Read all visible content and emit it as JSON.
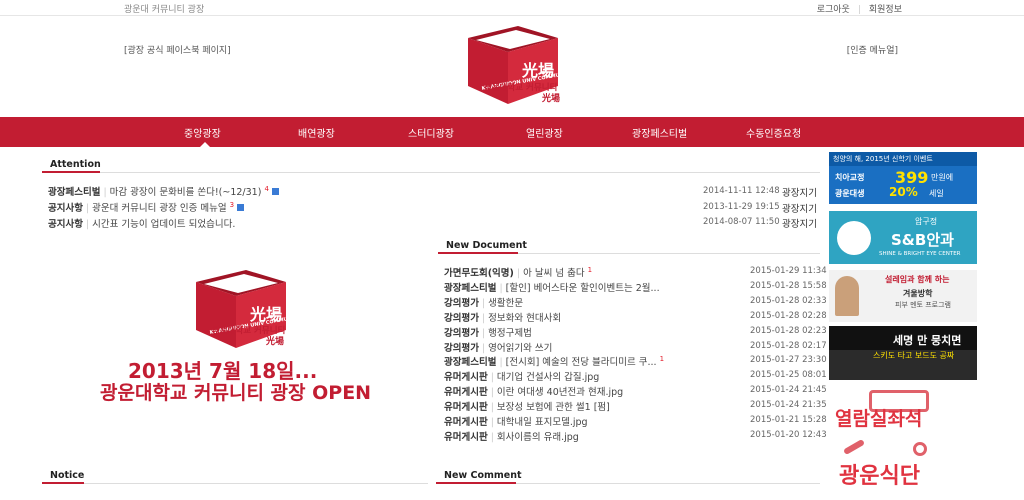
{
  "topbar": {
    "site_name": "광운대 커뮤니티 광장",
    "logout": "로그아웃",
    "member_info": "회원정보"
  },
  "header": {
    "left_link": "[광장 공식 페이스북 페이지]",
    "right_link": "[인증 메뉴얼]",
    "logo_text_main": "光場",
    "logo_text_sub": "광운대학교 커뮤니티",
    "logo_text_sub2": "光場",
    "logo_side": "KWANGWOON UNIV COMMUNITY"
  },
  "nav": {
    "items": [
      "중앙광장",
      "배연광장",
      "스터디광장",
      "열린광장",
      "광장페스티벌",
      "수동인증요청"
    ]
  },
  "attention": {
    "title": "Attention",
    "rows": [
      {
        "category": "광장페스티벌",
        "title": "마감 광장이 문화비를 쏜다!(~12/31)",
        "count": "4",
        "date": "2014-11-11",
        "time": "12:48",
        "author": "광장지기"
      },
      {
        "category": "공지사항",
        "title": "광운대 커뮤니티 광장 인증 메뉴얼",
        "count": "3",
        "date": "2013-11-29",
        "time": "19:15",
        "author": "광장지기"
      },
      {
        "category": "공지사항",
        "title": "시간표 기능이 업데이트 되었습니다.",
        "count": "",
        "date": "2014-08-07",
        "time": "11:50",
        "author": "광장지기"
      }
    ]
  },
  "banner": {
    "line1": "2013년 7월 18일...",
    "line2": "광운대학교 커뮤니티 광장 OPEN",
    "logo_main": "光場",
    "logo_sub": "광운대학교 커뮤니티",
    "logo_sub2": "光場",
    "logo_side": "KWANGWOON UNIV COMMUNITY"
  },
  "new_document": {
    "title": "New Document",
    "rows": [
      {
        "category": "가면무도회(익명)",
        "title": "아 날씨 넘 춥다",
        "count": "1",
        "date": "2015-01-29",
        "time": "11:34"
      },
      {
        "category": "광장페스티벌",
        "title": "[할인] 베어스타운 할인이벤트는 2월...",
        "count": "",
        "date": "2015-01-28",
        "time": "15:58"
      },
      {
        "category": "강의평가",
        "title": "생활한문",
        "count": "",
        "date": "2015-01-28",
        "time": "02:33"
      },
      {
        "category": "강의평가",
        "title": "정보화와 현대사회",
        "count": "",
        "date": "2015-01-28",
        "time": "02:28"
      },
      {
        "category": "강의평가",
        "title": "행정구제법",
        "count": "",
        "date": "2015-01-28",
        "time": "02:23"
      },
      {
        "category": "강의평가",
        "title": "영어읽기와 쓰기",
        "count": "",
        "date": "2015-01-28",
        "time": "02:17"
      },
      {
        "category": "광장페스티벌",
        "title": "[전시회] 예술의 전당 블라디미르 쿠...",
        "count": "1",
        "date": "2015-01-27",
        "time": "23:30"
      },
      {
        "category": "유머게시판",
        "title": "대기업 건설사의 갑질.jpg",
        "count": "",
        "date": "2015-01-25",
        "time": "08:01"
      },
      {
        "category": "유머게시판",
        "title": "이란 여대생 40년전과 현재.jpg",
        "count": "",
        "date": "2015-01-24",
        "time": "21:45"
      },
      {
        "category": "유머게시판",
        "title": "보장성 보험에 관한 썰1 [펌]",
        "count": "",
        "date": "2015-01-24",
        "time": "21:35"
      },
      {
        "category": "유머게시판",
        "title": "대학내일 표지모델.jpg",
        "count": "",
        "date": "2015-01-21",
        "time": "15:28"
      },
      {
        "category": "유머게시판",
        "title": "회사이름의 유래.jpg",
        "count": "",
        "date": "2015-01-20",
        "time": "12:43"
      }
    ]
  },
  "notice": {
    "title": "Notice"
  },
  "new_comment": {
    "title": "New Comment"
  },
  "ads": {
    "ad1": {
      "line1": "청양의 해, 2015년 신학기 이벤트",
      "line2": "치아교정",
      "price": "399",
      "line3": "만원에",
      "line4": "광운대생",
      "percent": "20%",
      "line5": "세일"
    },
    "ad2": {
      "line1": "압구정",
      "line2": "S&B안과",
      "line3": "SHINE & BRIGHT EYE CENTER"
    },
    "ad3": {
      "line1": "설레임과 함께 하는",
      "line2": "겨울방학",
      "line3": "피부 멘토 프로그램"
    },
    "ad4": {
      "line1": "세명 만 뭉치면",
      "line2": "스키도 타고 보드도 공짜"
    },
    "ad5": {
      "line1": "열람실좌석"
    },
    "ad6": {
      "line1": "광운식단"
    }
  },
  "colors": {
    "brand": "#c21d32",
    "count": "#e31c2a"
  }
}
